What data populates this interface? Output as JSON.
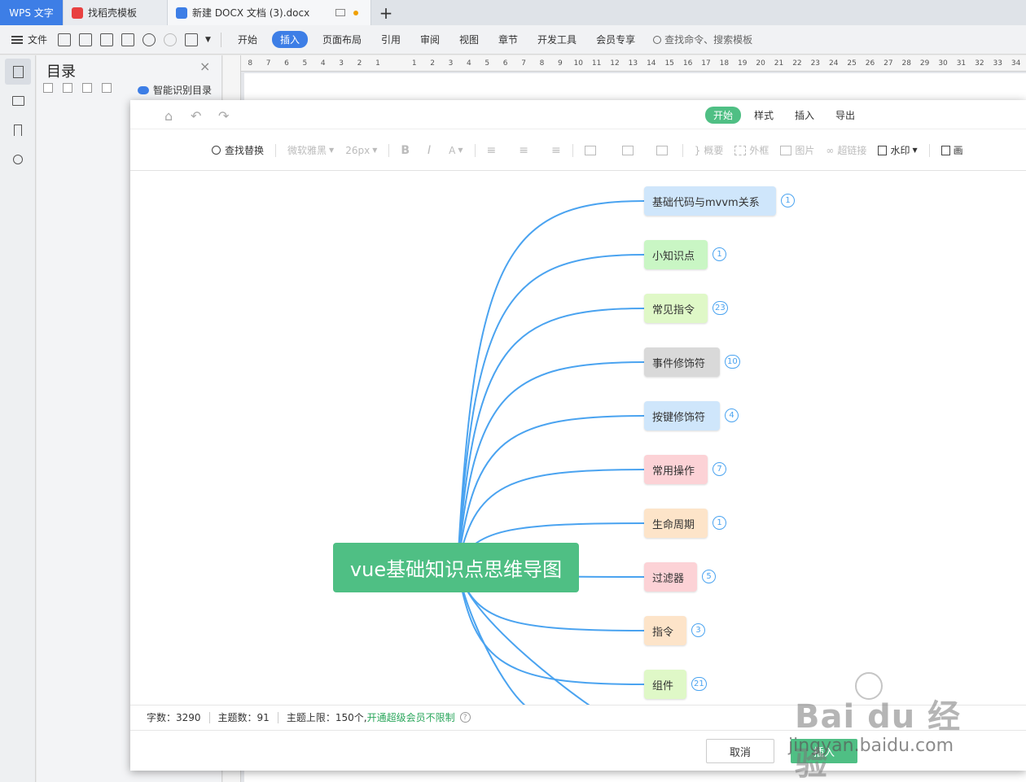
{
  "tabs": {
    "app": "WPS 文字",
    "t1": "找稻壳模板",
    "t2": "新建 DOCX 文档 (3).docx",
    "add": "+"
  },
  "menu": {
    "file": "文件",
    "items": [
      "开始",
      "插入",
      "页面布局",
      "引用",
      "审阅",
      "视图",
      "章节",
      "开发工具",
      "会员专享"
    ],
    "active": "插入",
    "search": "查找命令、搜索模板"
  },
  "toc": {
    "title": "目录",
    "close": "×",
    "smart": "智能识别目录"
  },
  "ruler": [
    "8",
    "7",
    "6",
    "5",
    "4",
    "3",
    "2",
    "1",
    "",
    "1",
    "2",
    "3",
    "4",
    "5",
    "6",
    "7",
    "8",
    "9",
    "10",
    "11",
    "12",
    "13",
    "14",
    "15",
    "16",
    "17",
    "18",
    "19",
    "20",
    "21",
    "22",
    "23",
    "24",
    "25",
    "26",
    "27",
    "28",
    "29",
    "30",
    "31",
    "32",
    "33",
    "34"
  ],
  "dialog": {
    "tabs": [
      "开始",
      "样式",
      "插入",
      "导出"
    ],
    "active_tab": "开始",
    "toolbar": {
      "find_replace": "查找替换",
      "font": "微软雅黑",
      "size": "26px",
      "bold": "B",
      "italic": "I",
      "color": "A",
      "summary": "概要",
      "frame": "外框",
      "image": "图片",
      "link": "超链接",
      "watermark": "水印",
      "more": "画"
    },
    "root": "vue基础知识点思维导图",
    "nodes": [
      {
        "label": "基础代码与mvvm关系",
        "count": "1",
        "bg": "#cfe6fb"
      },
      {
        "label": "小知识点",
        "count": "1",
        "bg": "#c9f6c4"
      },
      {
        "label": "常见指令",
        "count": "23",
        "bg": "#dff8c7"
      },
      {
        "label": "事件修饰符",
        "count": "10",
        "bg": "#d9d9d9"
      },
      {
        "label": "按键修饰符",
        "count": "4",
        "bg": "#cfe6fb"
      },
      {
        "label": "常用操作",
        "count": "7",
        "bg": "#fcd2d6"
      },
      {
        "label": "生命周期",
        "count": "1",
        "bg": "#fde4c9"
      },
      {
        "label": "过滤器",
        "count": "5",
        "bg": "#fcd2d6"
      },
      {
        "label": "指令",
        "count": "3",
        "bg": "#fde4c9"
      },
      {
        "label": "组件",
        "count": "21",
        "bg": "#dff8c7"
      }
    ],
    "status": {
      "words": "字数：3290",
      "topics": "主题数：91",
      "limit": "主题上限：150个,",
      "vip": "开通超级会员不限制",
      "help": "?"
    },
    "cancel": "取消",
    "ok": "插入"
  },
  "watermark": {
    "brand": "Bai du 经验",
    "url": "jingyan.baidu.com"
  },
  "colors": {
    "accent_green": "#4fbf84",
    "connector_blue": "#4aa3f0",
    "wps_blue": "#3d7ee6"
  }
}
